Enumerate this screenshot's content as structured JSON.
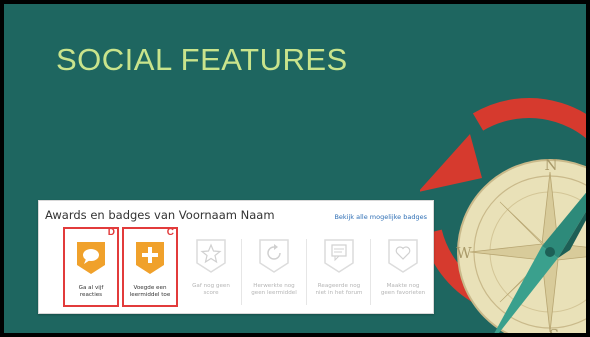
{
  "slide": {
    "title": "SOCIAL FEATURES"
  },
  "panel": {
    "title": "Awards en badges van Voornaam Naam",
    "link": "Bekijk alle mogelijke badges"
  },
  "badges": [
    {
      "line1": "Ga al vijf",
      "line2": "reacties",
      "letter": "D",
      "state": "active",
      "icon": "speech-bubble-icon"
    },
    {
      "line1": "Voegde een",
      "line2": "leermiddel toe",
      "letter": "C",
      "state": "active",
      "icon": "plus-icon"
    },
    {
      "line1": "Gaf nog geen",
      "line2": "score",
      "state": "inactive",
      "icon": "star-icon"
    },
    {
      "line1": "Herwerkte nog",
      "line2": "geen leermiddel",
      "state": "inactive",
      "icon": "refresh-icon"
    },
    {
      "line1": "Reageerde nog",
      "line2": "niet in het forum",
      "state": "inactive",
      "icon": "forum-icon"
    },
    {
      "line1": "Maakte nog",
      "line2": "geen favorieten",
      "state": "inactive",
      "icon": "heart-icon"
    }
  ],
  "compass": {
    "north": "N",
    "west": "W",
    "south": "S"
  },
  "colors": {
    "background": "#1e6660",
    "title": "#c9e48c",
    "badge_active": "#f0a12b",
    "highlight": "#e23b3b",
    "arrow": "#d63a2e"
  }
}
